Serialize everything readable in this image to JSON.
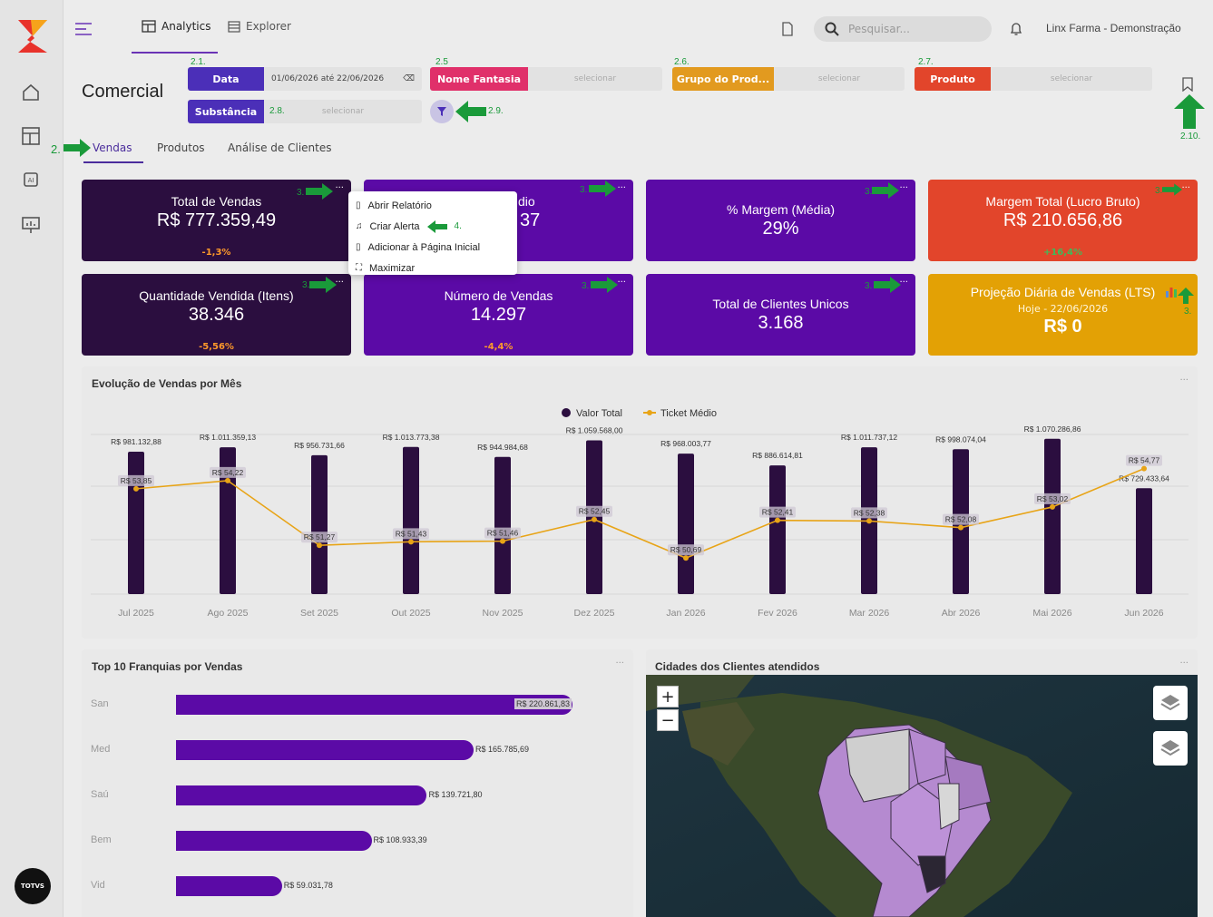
{
  "topbar": {
    "nav_analytics": "Analytics",
    "nav_explorer": "Explorer",
    "search_placeholder": "Pesquisar...",
    "tenant": "Linx Farma - Demonstração"
  },
  "page": {
    "title": "Comercial",
    "tabs": [
      "Vendas",
      "Produtos",
      "Análise de Clientes"
    ]
  },
  "filters": {
    "data_label": "Data",
    "data_value": "01/06/2026 até 22/06/2026",
    "nome_fantasia_label": "Nome Fantasia",
    "grupo_label": "Grupo do Prod...",
    "produto_label": "Produto",
    "substancia_label": "Substância",
    "select_placeholder": "selecionar"
  },
  "annotations": {
    "a21": "2.1.",
    "a25": "2.5",
    "a26": "2.6.",
    "a27": "2.7.",
    "a28": "2.8.",
    "a29": "2.9.",
    "a210": "2.10.",
    "a2": "2.",
    "a3": "3.",
    "a4": "4."
  },
  "cards": {
    "total_vendas": {
      "title": "Total de Vendas",
      "value": "R$ 777.359,49",
      "delta": "-1,3%"
    },
    "ticket_medio": {
      "title_fragment": "dio",
      "value_fragment": "37"
    },
    "margem_media": {
      "title": "% Margem (Média)",
      "value": "29%"
    },
    "margem_total": {
      "title": "Margem Total (Lucro Bruto)",
      "value": "R$ 210.656,86",
      "delta": "+16,4%"
    },
    "quantidade": {
      "title": "Quantidade Vendida (Itens)",
      "value": "38.346",
      "delta": "-5,56%"
    },
    "numero_vendas": {
      "title": "Número de Vendas",
      "value": "14.297",
      "delta": "-4,4%"
    },
    "clientes": {
      "title": "Total de Clientes Unicos",
      "value": "3.168"
    },
    "projecao": {
      "title": "Projeção Diária de Vendas (LTS)",
      "subtitle": "Hoje - 22/06/2026",
      "value": "R$ 0"
    }
  },
  "context_menu": {
    "items": [
      "Abrir Relatório",
      "Criar Alerta",
      "Adicionar à Página Inicial",
      "Maximizar"
    ]
  },
  "evolution_panel": {
    "title": "Evolução de Vendas por Mês"
  },
  "top10_panel": {
    "title": "Top 10 Franquias por Vendas"
  },
  "map_panel": {
    "title": "Cidades dos Clientes atendidos",
    "zoom_in": "+",
    "zoom_out": "−"
  },
  "colors": {
    "purple": "#5b0aa6",
    "dark_purple": "#2b0e3f",
    "red": "#e2452b",
    "orange": "#e3a105",
    "accent": "#6a33b5",
    "annotation_green": "#1a9a3a"
  },
  "chart_data": [
    {
      "type": "bar",
      "title": "Evolução de Vendas por Mês",
      "categories": [
        "Jul 2025",
        "Ago 2025",
        "Set 2025",
        "Out 2025",
        "Nov 2025",
        "Dez 2025",
        "Jan 2026",
        "Fev 2026",
        "Mar 2026",
        "Abr 2026",
        "Mai 2026",
        "Jun 2026"
      ],
      "series": [
        {
          "name": "Valor Total",
          "type": "bar",
          "values": [
            981132.88,
            1011359.13,
            956731.66,
            1013773.38,
            944984.68,
            1059568.0,
            968003.77,
            886614.81,
            1011737.12,
            998074.04,
            1070286.86,
            729433.64
          ],
          "labels": [
            "R$ 981.132,88",
            "R$ 1.011.359,13",
            "R$ 956.731,66",
            "R$ 1.013.773,38",
            "R$ 944.984,68",
            "R$ 1.059.568,00",
            "R$ 968.003,77",
            "R$ 886.614,81",
            "R$ 1.011.737,12",
            "R$ 998.074,04",
            "R$ 1.070.286,86",
            "R$ 729.433,64"
          ]
        },
        {
          "name": "Ticket Médio",
          "type": "line",
          "values": [
            53.85,
            54.22,
            51.27,
            51.43,
            51.46,
            52.45,
            50.69,
            52.41,
            52.38,
            52.08,
            53.02,
            54.77
          ],
          "labels": [
            "R$ 53,85",
            "R$ 54,22",
            "R$ 51,27",
            "R$ 51,43",
            "R$ 51,46",
            "R$ 52,45",
            "R$ 50,69",
            "R$ 52,41",
            "R$ 52,38",
            "R$ 52,08",
            "R$ 53,02",
            "R$ 54,77"
          ]
        }
      ],
      "legend": "top-center"
    },
    {
      "type": "bar",
      "title": "Top 10 Franquias por Vendas",
      "orientation": "horizontal",
      "categories": [
        "San",
        "Med",
        "Saú",
        "Bem",
        "Vid"
      ],
      "values": [
        220861.83,
        165785.69,
        139721.8,
        108933.39,
        59031.78
      ],
      "labels": [
        "R$ 220.861,83",
        "R$ 165.785,69",
        "R$ 139.721,80",
        "R$ 108.933,39",
        "R$ 59.031,78"
      ]
    }
  ]
}
